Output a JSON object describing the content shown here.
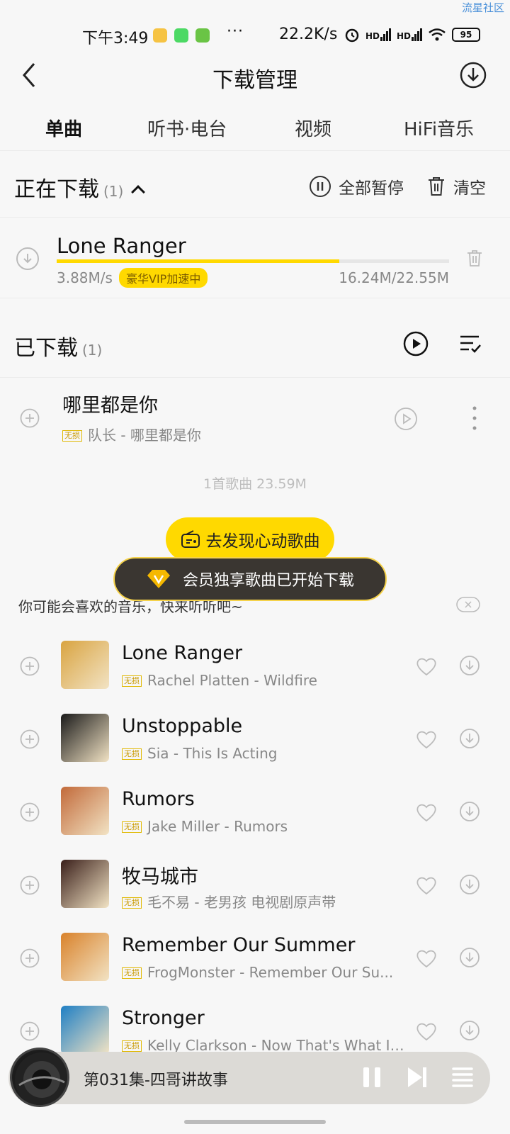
{
  "watermark": "流星社区",
  "status_bar": {
    "time": "下午3:49",
    "dots": "···",
    "net_speed": "22.2K/s",
    "sim1": "HD",
    "sim2": "HD",
    "battery": "95"
  },
  "header": {
    "title": "下载管理"
  },
  "tabs": [
    {
      "label": "单曲",
      "active": true
    },
    {
      "label": "听书·电台",
      "active": false
    },
    {
      "label": "视频",
      "active": false
    },
    {
      "label": "HiFi音乐",
      "active": false
    }
  ],
  "downloading": {
    "title": "正在下载",
    "count": "(1)",
    "pause_all": "全部暂停",
    "clear": "清空",
    "item": {
      "title": "Lone Ranger",
      "speed": "3.88M/s",
      "badge": "豪华VIP加速中",
      "size": "16.24M/22.55M",
      "progress": 0.72
    }
  },
  "downloaded": {
    "title": "已下载",
    "count": "(1)",
    "items": [
      {
        "title": "哪里都是你",
        "quality": "无损",
        "subtitle": "队长 - 哪里都是你"
      }
    ],
    "total": "1首歌曲 23.59M"
  },
  "discover_button": "去发现心动歌曲",
  "toast": "会员独享歌曲已开始下载",
  "recommend": {
    "header": "你可能会喜欢的音乐，快来听听吧~",
    "items": [
      {
        "title": "Lone Ranger",
        "quality": "无损",
        "subtitle": "Rachel Platten - Wildfire",
        "cover_color": "#d9a441"
      },
      {
        "title": "Unstoppable",
        "quality": "无损",
        "subtitle": "Sia - This Is Acting",
        "cover_color": "#1a1a1a"
      },
      {
        "title": "Rumors",
        "quality": "无损",
        "subtitle": "Jake Miller - Rumors",
        "cover_color": "#c26a3a"
      },
      {
        "title": "牧马城市",
        "quality": "无损",
        "subtitle": "毛不易 - 老男孩 电视剧原声带",
        "cover_color": "#3a1f1a"
      },
      {
        "title": "Remember Our Summer",
        "quality": "无损",
        "subtitle": "FrogMonster - Remember Our Su...",
        "cover_color": "#d9822b"
      },
      {
        "title": "Stronger",
        "quality": "无损",
        "subtitle": "Kelly Clarkson - Now That's What I ...",
        "cover_color": "#1f7fc4"
      }
    ]
  },
  "player": {
    "title": "第031集-四哥讲故事"
  },
  "colors": {
    "accent": "#ffd900",
    "background": "#f7f7f7"
  }
}
